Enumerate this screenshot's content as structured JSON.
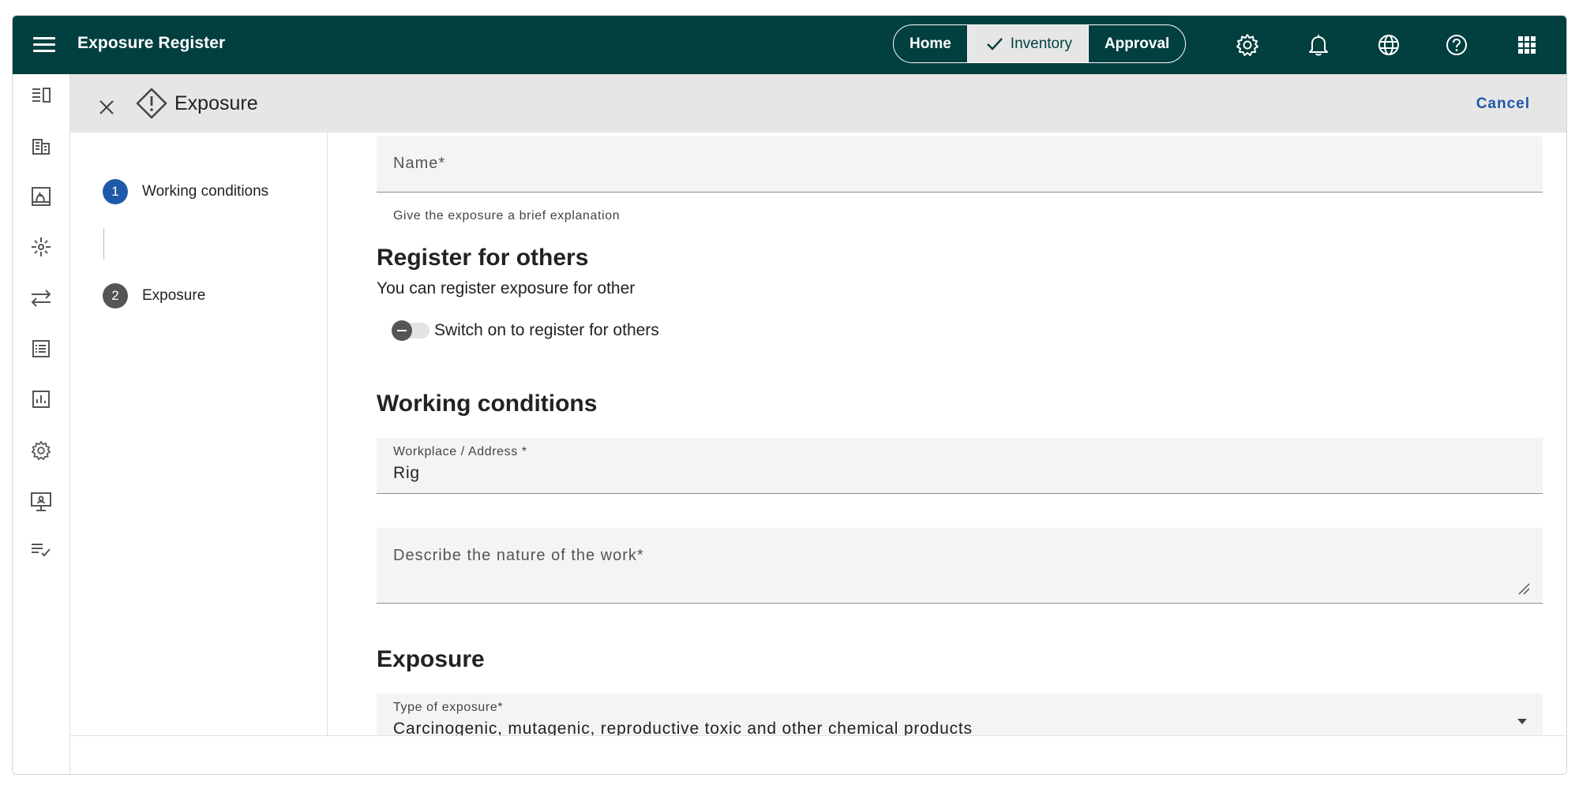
{
  "app": {
    "title": "Exposure Register"
  },
  "nav": {
    "home": "Home",
    "inventory": "Inventory",
    "approval": "Approval",
    "active": "inventory"
  },
  "top_icons": [
    "settings-icon",
    "bell-icon",
    "globe-icon",
    "help-icon",
    "apps-grid-icon"
  ],
  "rail_icons": [
    "list-panel-icon",
    "buildings-icon",
    "fire-image-icon",
    "sparkle-icon",
    "swap-arrows-icon",
    "checklist-icon",
    "bar-chart-icon",
    "settings-icon",
    "presentation-icon",
    "list-check-icon"
  ],
  "panel": {
    "title": "Exposure",
    "cancel": "Cancel"
  },
  "steps": [
    {
      "number": "1",
      "label": "Working conditions",
      "active": true
    },
    {
      "number": "2",
      "label": "Exposure",
      "active": false
    }
  ],
  "form": {
    "name": {
      "placeholder": "Name*",
      "helper": "Give the exposure a brief explanation"
    },
    "register_others": {
      "title": "Register for others",
      "subtitle": "You can register exposure for other",
      "toggle_label": "Switch on to register for others",
      "toggle_on": false
    },
    "working_conditions": {
      "title": "Working conditions",
      "workplace_label": "Workplace / Address *",
      "workplace_value": "Rig",
      "nature_placeholder": "Describe the nature of the work*"
    },
    "exposure": {
      "title": "Exposure",
      "type_label": "Type of exposure*",
      "type_value": "Carcinogenic, mutagenic, reproductive toxic and other chemical products"
    }
  },
  "colors": {
    "topbar": "#023f3f",
    "accent": "#1e5aa8",
    "header_strip": "#e6e6e6",
    "field_bg": "#f4f4f4"
  }
}
